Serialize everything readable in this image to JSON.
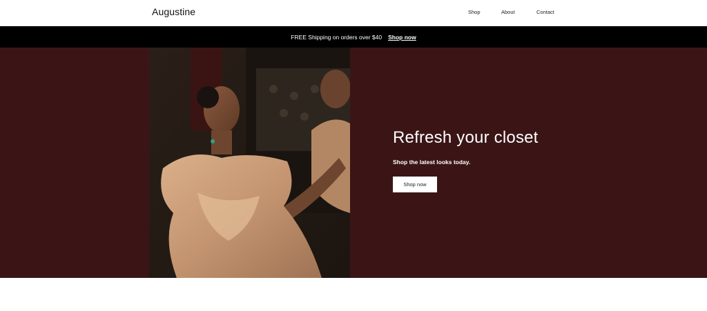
{
  "header": {
    "logo": "Augustine",
    "nav": [
      "Shop",
      "About",
      "Contact"
    ]
  },
  "promo": {
    "text": "FREE Shipping on orders over $40",
    "link": "Shop now"
  },
  "hero": {
    "title": "Refresh your closet",
    "subtitle": "Shop the latest looks today.",
    "button": "Shop now",
    "background_color": "#3b1516"
  },
  "colors": {
    "promo_bar": "#000000",
    "hero_bg": "#3b1516",
    "button_bg": "#ffffff"
  }
}
